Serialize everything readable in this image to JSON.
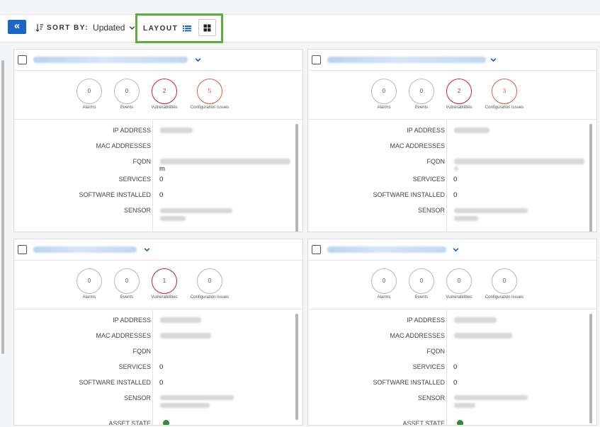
{
  "toolbar": {
    "collapse_icon": "double-chevron-left-icon",
    "sort_label": "SORT BY:",
    "sort_value": "Updated",
    "layout_label": "LAYOUT",
    "accent_color": "#1a66c7",
    "highlight_color": "#5cae3c"
  },
  "cards": [
    {
      "metrics": [
        {
          "value": "0",
          "label": "Alarms",
          "status": "neutral"
        },
        {
          "value": "0",
          "label": "Events",
          "status": "neutral"
        },
        {
          "value": "2",
          "label": "Vulnerabilities",
          "status": "red"
        },
        {
          "value": "5",
          "label": "Configuration issues",
          "status": "orange"
        }
      ],
      "fields": {
        "ip_label": "IP ADDRESS",
        "mac_label": "MAC ADDRESSES",
        "fqdn_label": "FQDN",
        "fqdn_suffix": "m",
        "services_label": "SERVICES",
        "services_value": "0",
        "software_label": "SOFTWARE INSTALLED",
        "software_value": "0",
        "sensor_label": "SENSOR"
      }
    },
    {
      "metrics": [
        {
          "value": "0",
          "label": "Alarms",
          "status": "neutral"
        },
        {
          "value": "0",
          "label": "Events",
          "status": "neutral"
        },
        {
          "value": "2",
          "label": "Vulnerabilities",
          "status": "red"
        },
        {
          "value": "3",
          "label": "Configuration issues",
          "status": "orange"
        }
      ],
      "fields": {
        "ip_label": "IP ADDRESS",
        "mac_label": "MAC ADDRESSES",
        "fqdn_label": "FQDN",
        "services_label": "SERVICES",
        "services_value": "0",
        "software_label": "SOFTWARE INSTALLED",
        "software_value": "0",
        "sensor_label": "SENSOR"
      }
    },
    {
      "metrics": [
        {
          "value": "0",
          "label": "Alarms",
          "status": "neutral"
        },
        {
          "value": "0",
          "label": "Events",
          "status": "neutral"
        },
        {
          "value": "1",
          "label": "Vulnerabilities",
          "status": "red"
        },
        {
          "value": "0",
          "label": "Configuration issues",
          "status": "neutral"
        }
      ],
      "fields": {
        "ip_label": "IP ADDRESS",
        "mac_label": "MAC ADDRESSES",
        "fqdn_label": "FQDN",
        "services_label": "SERVICES",
        "services_value": "0",
        "software_label": "SOFTWARE INSTALLED",
        "software_value": "0",
        "sensor_label": "SENSOR",
        "asset_state_label": "ASSET STATE"
      }
    },
    {
      "metrics": [
        {
          "value": "0",
          "label": "Alarms",
          "status": "neutral"
        },
        {
          "value": "0",
          "label": "Events",
          "status": "neutral"
        },
        {
          "value": "0",
          "label": "Vulnerabilities",
          "status": "neutral"
        },
        {
          "value": "0",
          "label": "Configuration issues",
          "status": "neutral"
        }
      ],
      "fields": {
        "ip_label": "IP ADDRESS",
        "mac_label": "MAC ADDRESSES",
        "fqdn_label": "FQDN",
        "services_label": "SERVICES",
        "services_value": "0",
        "software_label": "SOFTWARE INSTALLED",
        "software_value": "0",
        "sensor_label": "SENSOR",
        "asset_state_label": "ASSET STATE"
      }
    }
  ]
}
